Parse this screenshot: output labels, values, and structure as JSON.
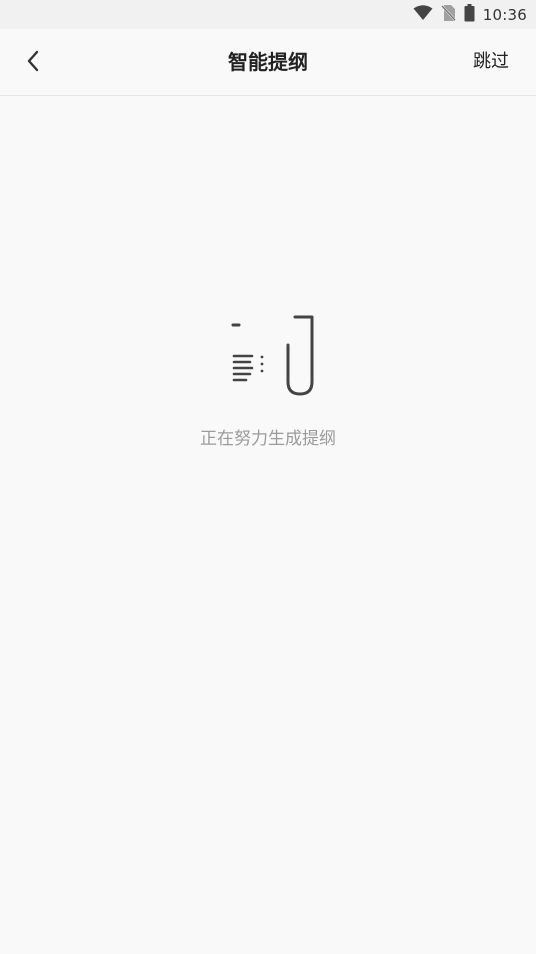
{
  "status_bar": {
    "time": "10:36",
    "icons": [
      "wifi-icon",
      "no-sim-icon",
      "battery-icon"
    ]
  },
  "nav": {
    "back_icon": "chevron-left-icon",
    "title": "智能提纲",
    "skip_label": "跳过"
  },
  "main": {
    "loading_icon": "document-clip-icon",
    "loading_text": "正在努力生成提纲"
  },
  "colors": {
    "background": "#f9f9f9",
    "status_bar": "#f1f1f1",
    "title_text": "#222222",
    "hint_text": "#9b9b9b",
    "icon_stroke": "#444444"
  }
}
